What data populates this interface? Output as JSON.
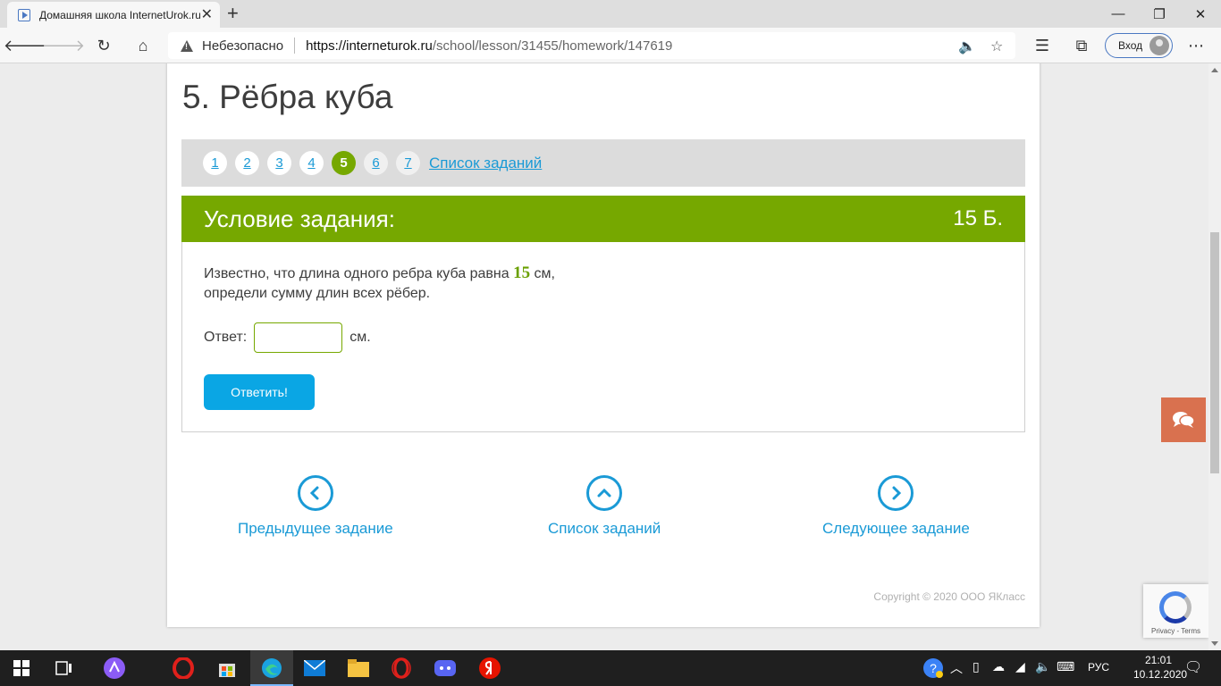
{
  "browser": {
    "tab_title": "Домашняя школа InternetUrok.ru",
    "new_tab": "+",
    "security_label": "Небезопасно",
    "url_host": "https://interneturok.ru",
    "url_path": "/school/lesson/31455/homework/147619",
    "signin_label": "Вход"
  },
  "page": {
    "title": "5. Рёбра куба",
    "task_numbers": [
      "1",
      "2",
      "3",
      "4",
      "5",
      "6",
      "7"
    ],
    "active_task": "5",
    "task_list_link": "Список заданий",
    "condition_title": "Условие задания:",
    "points": "15 Б.",
    "task_text_before": "Известно, что длина одного ребра куба равна ",
    "task_number": "15",
    "task_text_after": " см,",
    "task_text_line2": "определи сумму длин всех рёбер.",
    "answer_label": "Ответ:",
    "answer_value": "",
    "answer_unit": "см.",
    "submit_label": "Ответить!",
    "prev_label": "Предыдущее задание",
    "list_label": "Список заданий",
    "next_label": "Следующее задание",
    "copyright": "Copyright © 2020 ООО ЯКласс"
  },
  "recaptcha": {
    "text": "Privacy - Terms"
  },
  "taskbar": {
    "language": "РУС",
    "time": "21:01",
    "date": "10.12.2020"
  },
  "colors": {
    "accent_green": "#76a800",
    "link_blue": "#1a9ad6",
    "button_blue": "#0aa6e4",
    "chat_orange": "#d9714f"
  }
}
